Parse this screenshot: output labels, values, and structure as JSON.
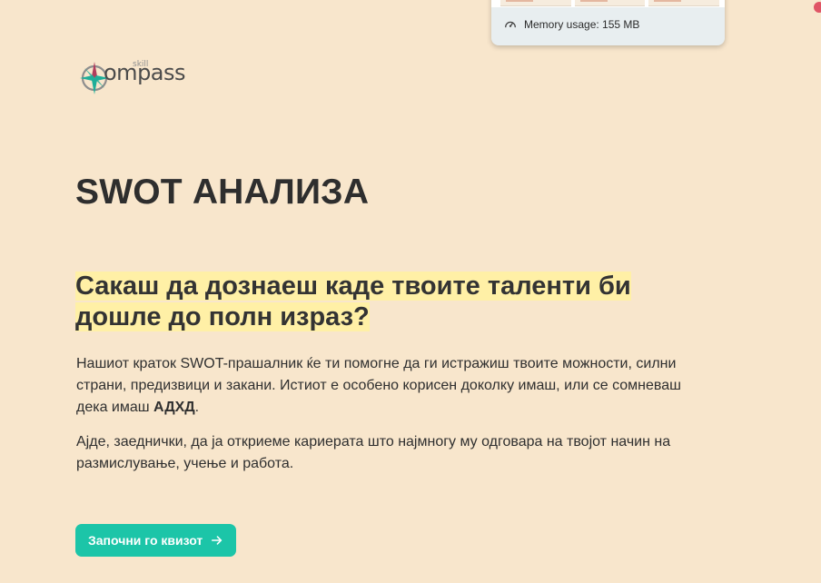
{
  "memory_popup": {
    "label": "Memory usage: 155 MB",
    "icon": "gauge-icon"
  },
  "logo": {
    "wordmark": "ompass",
    "superscript": "skill"
  },
  "main": {
    "title": "SWOT АНАЛИЗА",
    "headline": "Сакаш да дознаеш каде твоите таленти би дошле до полн израз?",
    "paragraph1_text": "Нашиот краток SWOT-прашалник ќе ти помогне да ги истражиш твоите можности, силни страни, предизвици и закани. Истиот е особено корисен доколку имаш, или се сомневаш дека имаш ",
    "paragraph1_bold": "АДХД",
    "paragraph1_end": ".",
    "paragraph2": "Ајде, заеднички, да ја откриеме кариерата што најмногу му одговара на твојот начин на размислување, учење и работа.",
    "start_button": "Започни го квизот"
  },
  "colors": {
    "background": "#f8e6cc",
    "highlight": "#fff0a6",
    "accent": "#1cc5a8",
    "text": "#2f2f2f"
  }
}
